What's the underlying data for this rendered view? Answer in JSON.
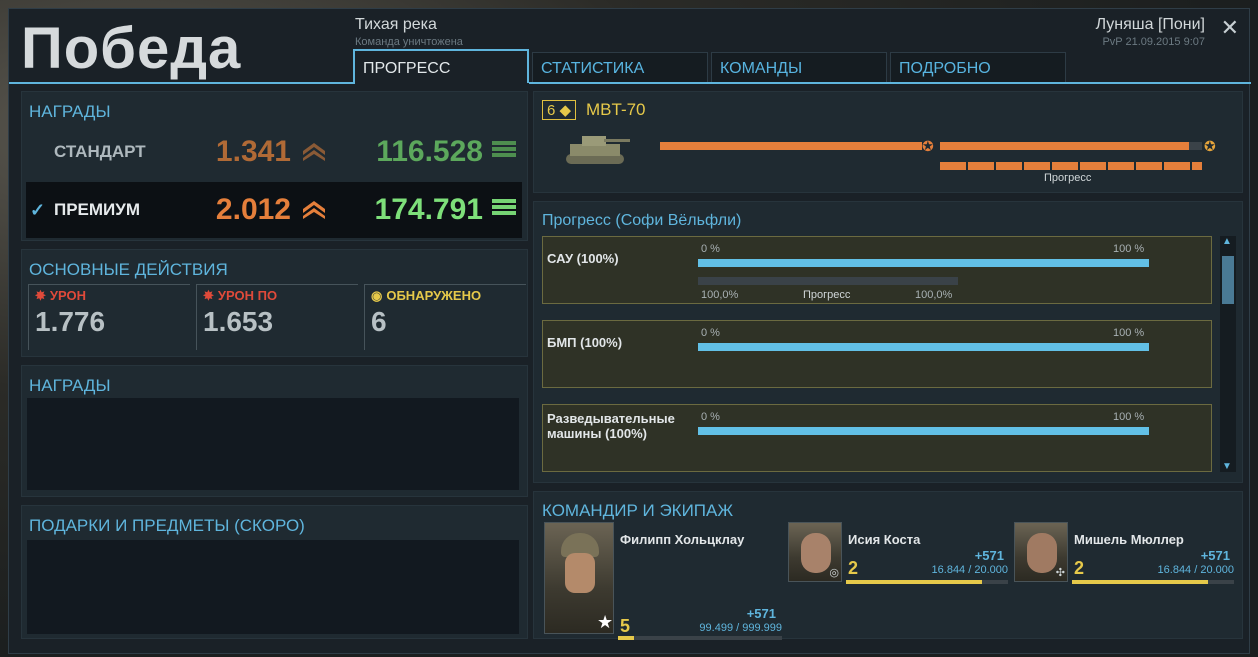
{
  "header": {
    "result": "Победа",
    "map_name": "Тихая река",
    "map_sub": "Команда уничтожена",
    "player": "Луняша [Пони]",
    "mode": "PvP 21.09.2015 9:07",
    "close": "✕"
  },
  "tabs": [
    {
      "label": "ПРОГРЕСС",
      "active": true
    },
    {
      "label": "СТАТИСТИКА",
      "active": false
    },
    {
      "label": "КОМАНДЫ",
      "active": false
    },
    {
      "label": "ПОДРОБНО",
      "active": false
    }
  ],
  "rewards": {
    "title": "НАГРАДЫ",
    "standard": {
      "label": "СТАНДАРТ",
      "xp": "1.341",
      "credits": "116.528"
    },
    "premium": {
      "label": "ПРЕМИУМ",
      "check": "✓",
      "xp": "2.012",
      "credits": "174.791"
    }
  },
  "actions": {
    "title": "ОСНОВНЫЕ ДЕЙСТВИЯ",
    "items": [
      {
        "label": "УРОН",
        "value": "1.776",
        "color": "#e04a3a"
      },
      {
        "label": "УРОН ПО",
        "value": "1.653",
        "color": "#e04a3a"
      },
      {
        "label": "ОБНАРУЖЕНО",
        "value": "6",
        "color": "#e6c94a"
      }
    ]
  },
  "awards": {
    "title": "НАГРАДЫ"
  },
  "gifts": {
    "title": "ПОДАРКИ И ПРЕДМЕТЫ (СКОРО)"
  },
  "vehicle": {
    "tier": "6 ◆",
    "name": "MBT-70",
    "progress_label": "Прогресс",
    "progress": 0.95
  },
  "crew_progress": {
    "title": "Прогресс (Софи Вёльфли)",
    "categories": [
      {
        "name": "САУ (100%)",
        "left": "0 %",
        "right": "100 %",
        "sub_left": "100,0%",
        "sub_mid": "Прогресс",
        "sub_right": "100,0%",
        "progress": 1.0
      },
      {
        "name": "БМП (100%)",
        "left": "0 %",
        "right": "100 %",
        "progress": 1.0
      },
      {
        "name": "Разведывательные машины (100%)",
        "left": "0 %",
        "right": "100 %",
        "progress": 1.0
      }
    ]
  },
  "crew": {
    "title": "КОМАНДИР И ЭКИПАЖ",
    "members": [
      {
        "name": "Филипп Хольцклау",
        "level": "5",
        "gain": "+571",
        "xp": "99.499 / 999.999",
        "fill": 0.1
      },
      {
        "name": "Исия Коста",
        "level": "2",
        "gain": "+571",
        "xp": "16.844 / 20.000",
        "fill": 0.84
      },
      {
        "name": "Мишель Мюллер",
        "level": "2",
        "gain": "+571",
        "xp": "16.844 / 20.000",
        "fill": 0.84
      }
    ]
  },
  "colors": {
    "accent": "#5fb5dd",
    "xp": "#e57f3b",
    "credits": "#7ee07a",
    "gold": "#e6c94a"
  }
}
